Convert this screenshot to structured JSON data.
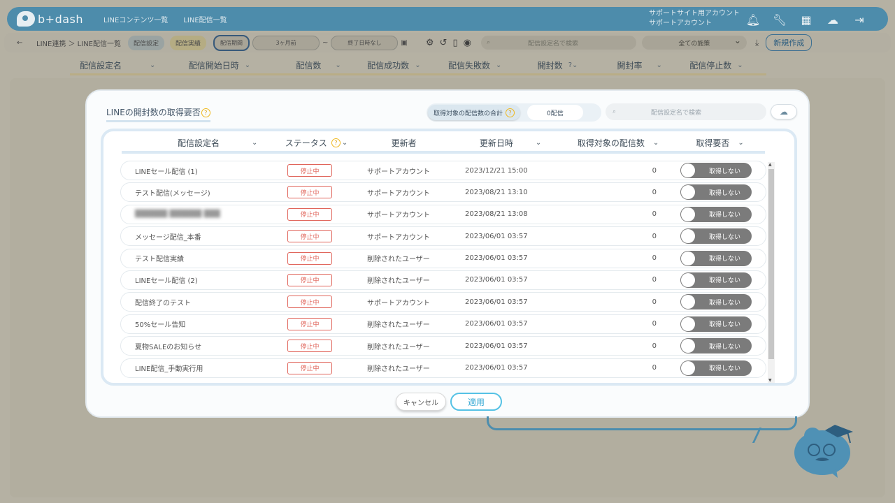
{
  "app": {
    "logo_text": "b+dash",
    "nav": [
      "LINEコンテンツ一覧",
      "LINE配信一覧"
    ],
    "account_line1": "サポートサイト用アカウント",
    "account_line2": "サポートアカウント"
  },
  "subbar": {
    "breadcrumb": "LINE連携 ＞ LINE配信一覧",
    "tab_settings": "配信設定",
    "tab_results": "配信実績",
    "period_label": "配信期間",
    "period_from": "3ヶ月前",
    "period_sep": "~",
    "period_to": "終了日時なし",
    "search_placeholder": "配信設定名で検索",
    "filter_select": "全ての施策",
    "new_button": "新規作成"
  },
  "bg_table": {
    "columns": [
      "配信設定名",
      "配信開始日時",
      "配信数",
      "配信成功数",
      "配信失敗数",
      "開封数",
      "開封率",
      "配信停止数"
    ]
  },
  "modal": {
    "title": "LINEの開封数の取得要否",
    "total_label": "取得対象の配信数の合計",
    "total_value": "0配信",
    "search_placeholder": "配信設定名で検索",
    "columns": {
      "name": "配信設定名",
      "status": "ステータス",
      "updater": "更新者",
      "updated_at": "更新日時",
      "target_count": "取得対象の配信数",
      "fetch": "取得要否"
    },
    "rows": [
      {
        "name": "LINEセール配信 (1)",
        "status": "停止中",
        "updater": "サポートアカウント",
        "updated_at": "2023/12/21 15:00",
        "count": "0",
        "toggle": "取得しない"
      },
      {
        "name": "テスト配信(メッセージ)",
        "status": "停止中",
        "updater": "サポートアカウント",
        "updated_at": "2023/08/21 13:10",
        "count": "0",
        "toggle": "取得しない"
      },
      {
        "name": "",
        "status": "停止中",
        "updater": "サポートアカウント",
        "updated_at": "2023/08/21 13:08",
        "count": "0",
        "toggle": "取得しない"
      },
      {
        "name": "メッセージ配信_本番",
        "status": "停止中",
        "updater": "サポートアカウント",
        "updated_at": "2023/06/01 03:57",
        "count": "0",
        "toggle": "取得しない"
      },
      {
        "name": "テスト配信実績",
        "status": "停止中",
        "updater": "削除されたユーザー",
        "updated_at": "2023/06/01 03:57",
        "count": "0",
        "toggle": "取得しない"
      },
      {
        "name": "LINEセール配信 (2)",
        "status": "停止中",
        "updater": "削除されたユーザー",
        "updated_at": "2023/06/01 03:57",
        "count": "0",
        "toggle": "取得しない"
      },
      {
        "name": "配信終了のテスト",
        "status": "停止中",
        "updater": "サポートアカウント",
        "updated_at": "2023/06/01 03:57",
        "count": "0",
        "toggle": "取得しない"
      },
      {
        "name": "50%セール告知",
        "status": "停止中",
        "updater": "削除されたユーザー",
        "updated_at": "2023/06/01 03:57",
        "count": "0",
        "toggle": "取得しない"
      },
      {
        "name": "夏物SALEのお知らせ",
        "status": "停止中",
        "updater": "削除されたユーザー",
        "updated_at": "2023/06/01 03:57",
        "count": "0",
        "toggle": "取得しない"
      },
      {
        "name": "LINE配信_手動実行用",
        "status": "停止中",
        "updater": "削除されたユーザー",
        "updated_at": "2023/06/01 03:57",
        "count": "0",
        "toggle": "取得しない"
      }
    ],
    "cancel_label": "キャンセル",
    "apply_label": "適用"
  }
}
